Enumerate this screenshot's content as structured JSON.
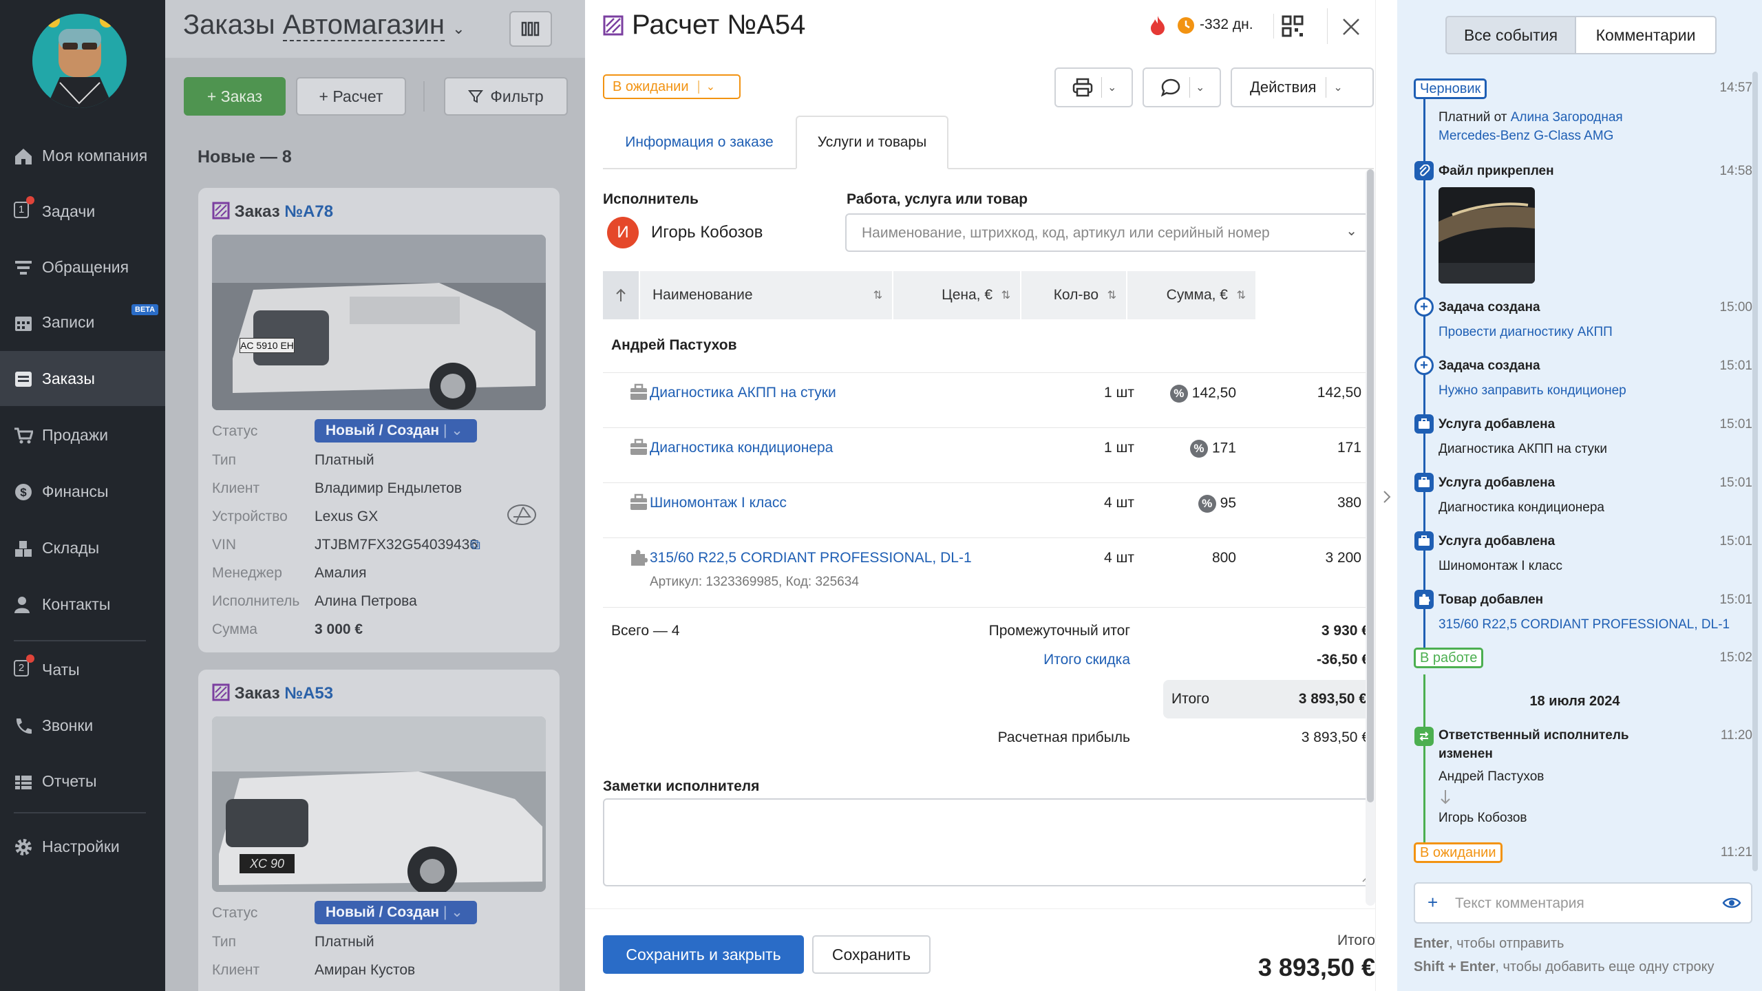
{
  "sidebar": {
    "items": [
      {
        "label": "Моя компания",
        "icon": "home-icon"
      },
      {
        "label": "Задачи",
        "icon": "tasks-icon",
        "badge": "1"
      },
      {
        "label": "Обращения",
        "icon": "funnel-icon"
      },
      {
        "label": "Записи",
        "icon": "calendar-icon",
        "beta": "BETA"
      },
      {
        "label": "Заказы",
        "icon": "orders-icon"
      },
      {
        "label": "Продажи",
        "icon": "cart-icon"
      },
      {
        "label": "Финансы",
        "icon": "dollar-icon"
      },
      {
        "label": "Склады",
        "icon": "boxes-icon"
      },
      {
        "label": "Контакты",
        "icon": "contacts-icon"
      },
      {
        "label": "Чаты",
        "icon": "chat-icon",
        "badge": "2"
      },
      {
        "label": "Звонки",
        "icon": "phone-icon"
      },
      {
        "label": "Отчеты",
        "icon": "reports-icon"
      },
      {
        "label": "Настройки",
        "icon": "gear-icon"
      }
    ]
  },
  "board": {
    "title_prefix": "Заказы",
    "title_location": "Автомагазин",
    "add_order_label": "+ Заказ",
    "add_calc_label": "+ Расчет",
    "filter_label": "Фильтр",
    "column_title": "Новые — 8",
    "cards": [
      {
        "title": "Заказ",
        "number": "№A78",
        "status": "Новый / Создан",
        "fields": [
          {
            "label": "Тип",
            "value": "Платный"
          },
          {
            "label": "Клиент",
            "value": "Владимир Ендылетов"
          },
          {
            "label": "Устройство",
            "value": "Lexus GX"
          },
          {
            "label": "VIN",
            "value": "JTJBM7FX32G54039436"
          },
          {
            "label": "Менеджер",
            "value": "Амалия"
          },
          {
            "label": "Исполнитель",
            "value": "Алина Петрова"
          },
          {
            "label": "Сумма",
            "value": "3 000 €"
          }
        ],
        "status_label": "Статус",
        "plate": "AC 5910 EH"
      },
      {
        "title": "Заказ",
        "number": "№A53",
        "status": "Новый / Создан",
        "fields": [
          {
            "label": "Тип",
            "value": "Платный"
          },
          {
            "label": "Клиент",
            "value": "Амиран Кустов"
          }
        ],
        "status_label": "Статус",
        "plate": "XC 90"
      }
    ]
  },
  "modal": {
    "title": "Расчет №A54",
    "days": "-332 дн.",
    "status": "В ожидании",
    "actions_label": "Действия",
    "tabs": [
      "Информация о заказе",
      "Услуги и товары"
    ],
    "executor_label": "Исполнитель",
    "executor_initial": "И",
    "executor_name": "Игорь Кобозов",
    "work_label": "Работа, услуга или товар",
    "work_placeholder": "Наименование, штрихкод, код, артикул или серийный номер",
    "table": {
      "headers": [
        "Наименование",
        "Цена, €",
        "Кол-во",
        "Сумма, €"
      ],
      "group": "Андрей Пастухов",
      "rows": [
        {
          "name": "Диагностика АКПП на стуки",
          "price": "142,50",
          "qty": "1 шт",
          "sum": "142,50",
          "discount": true
        },
        {
          "name": "Диагностика кондиционера",
          "price": "171",
          "qty": "1 шт",
          "sum": "171",
          "discount": true
        },
        {
          "name": "Шиномонтаж I класс",
          "price": "95",
          "qty": "4 шт",
          "sum": "380",
          "discount": true
        },
        {
          "name": "315/60 R22,5 CORDIANT PROFESSIONAL, DL-1",
          "price": "800",
          "qty": "4 шт",
          "sum": "3 200",
          "sub": "Артикул: 1323369985, Код: 325634",
          "discount": false
        }
      ]
    },
    "total_count": "Всего — 4",
    "subtotal_label": "Промежуточный итог",
    "subtotal": "3 930 €",
    "discount_label": "Итого скидка",
    "discount": "-36,50 €",
    "total_label": "Итого",
    "total": "3 893,50 €",
    "profit_label": "Расчетная прибыль",
    "profit": "3 893,50 €",
    "notes_label": "Заметки исполнителя",
    "save_close_label": "Сохранить и закрыть",
    "save_label": "Сохранить",
    "footer_total_label": "Итого",
    "footer_total": "3 893,50 €"
  },
  "rpanel": {
    "tabs": [
      "Все события",
      "Комментарии"
    ],
    "events": [
      {
        "tag": "Черновик",
        "time": "14:57",
        "text": "Платний от ",
        "link": "Алина Загородная",
        "link2": "Mercedes-Benz G-Class AMG"
      },
      {
        "title": "Файл прикреплен",
        "time": "14:58"
      },
      {
        "title": "Задача создана",
        "time": "15:00",
        "link": "Провести диагностику АКПП"
      },
      {
        "title": "Задача создана",
        "time": "15:01",
        "link": "Нужно заправить кондиционер"
      },
      {
        "title": "Услуга добавлена",
        "time": "15:01",
        "text": "Диагностика АКПП на стуки"
      },
      {
        "title": "Услуга добавлена",
        "time": "15:01",
        "text": "Диагностика кондиционера"
      },
      {
        "title": "Услуга добавлена",
        "time": "15:01",
        "text": "Шиномонтаж I класс"
      },
      {
        "title": "Товар добавлен",
        "time": "15:01",
        "link": "315/60 R22,5 CORDIANT PROFESSIONAL, DL-1"
      },
      {
        "tag": "В работе",
        "time": "15:02"
      },
      {
        "date": "18 июля 2024"
      },
      {
        "title": "Ответственный исполнитель",
        "title2": "изменен",
        "time": "11:20",
        "from": "Андрей Пастухов",
        "to": "Игорь Кобозов"
      },
      {
        "tag": "В ожидании",
        "time": "11:21"
      }
    ],
    "comment_placeholder": "Текст комментария",
    "hint1_key": "Enter",
    "hint1_text": ", чтобы отправить",
    "hint2_key": "Shift + Enter",
    "hint2_text": ", чтобы добавить еще одну строку"
  },
  "colors": {
    "accent_blue": "#1f5fb4",
    "save_blue": "#2a6cc7",
    "status_orange": "#f29312",
    "status_green": "#4caf50",
    "draft_blue": "#1f5fb4",
    "purple": "#7b3fa0",
    "add_green": "#3d9a3f"
  }
}
